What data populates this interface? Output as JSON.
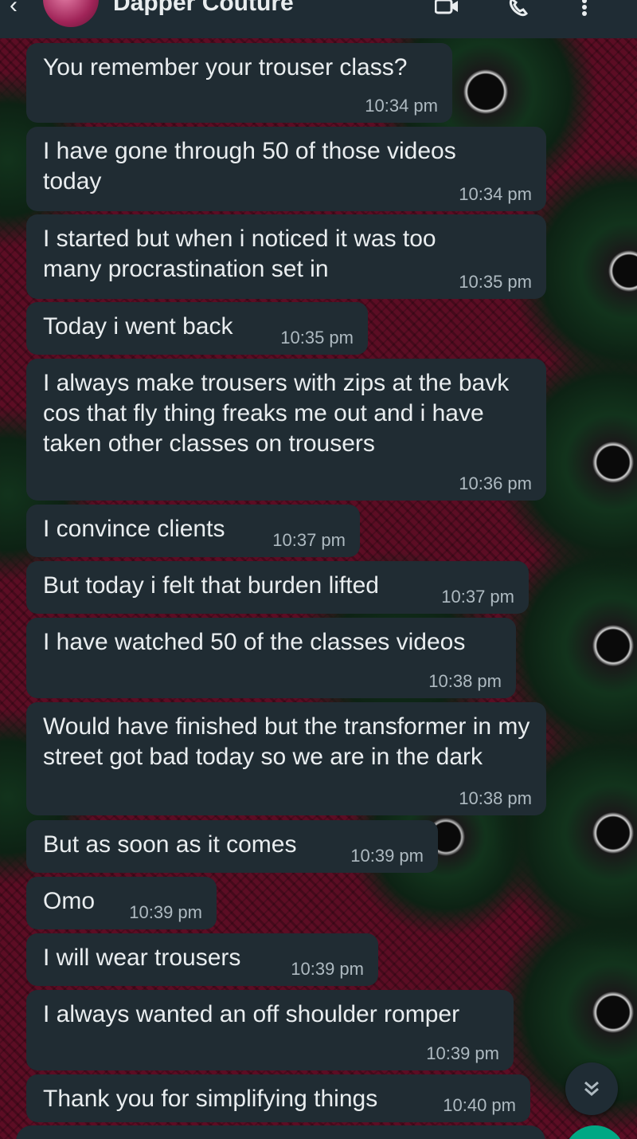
{
  "header": {
    "contact_name": "Dapper Couture",
    "icons": [
      "back-arrow-icon",
      "video-call-icon",
      "voice-call-icon",
      "more-options-icon"
    ]
  },
  "messages": [
    {
      "text": "You remember your trouser class?",
      "time": "10:34 pm"
    },
    {
      "text": "I have gone through 50 of those videos today",
      "time": "10:34 pm"
    },
    {
      "text": "I started but when i noticed it was too many procrastination set in",
      "time": "10:35 pm"
    },
    {
      "text": "Today i went back",
      "time": "10:35 pm"
    },
    {
      "text": "I always make trousers with zips at the bavk cos that fly thing freaks me out and i have taken other classes on trousers",
      "time": "10:36 pm"
    },
    {
      "text": "I convince clients",
      "time": "10:37 pm"
    },
    {
      "text": "But today i felt that burden lifted",
      "time": "10:37 pm"
    },
    {
      "text": "I have watched 50 of the classes videos",
      "time": "10:38 pm"
    },
    {
      "text": "Would have finished but the transformer in my street got bad today so we are in the dark",
      "time": "10:38 pm"
    },
    {
      "text": "But as soon as it comes",
      "time": "10:39 pm"
    },
    {
      "text": "Omo",
      "time": "10:39 pm"
    },
    {
      "text": "I will wear trousers",
      "time": "10:39 pm"
    },
    {
      "text": "I always wanted an off shoulder romper",
      "time": "10:39 pm"
    },
    {
      "text": "Thank you for simplifying things",
      "time": "10:40 pm"
    }
  ],
  "colors": {
    "bubble": "#202c33",
    "header": "#1f2c34",
    "accent": "#00a884",
    "wallpaper": "#5c0d24"
  }
}
